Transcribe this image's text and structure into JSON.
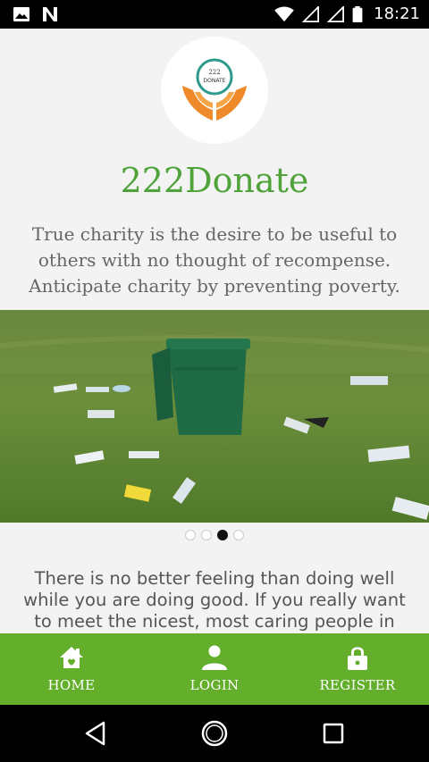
{
  "status_bar": {
    "time": "18:21"
  },
  "app": {
    "logo_text_top": "222",
    "logo_text_bottom": "DONATE",
    "title": "222Donate",
    "quote": "True charity is the desire to be useful to others with no thought of recompense. Anticipate charity by preventing poverty."
  },
  "carousel": {
    "slide_count": 4,
    "active_index": 2
  },
  "paragraph": "There is no better feeling than doing well while you are doing good. If you really want to meet the nicest, most caring people in",
  "bottom_nav": {
    "items": [
      {
        "label": "HOME",
        "icon": "home-icon"
      },
      {
        "label": "LOGIN",
        "icon": "person-icon"
      },
      {
        "label": "REGISTER",
        "icon": "lock-icon"
      }
    ]
  },
  "colors": {
    "accent": "#63ae2a",
    "title": "#4fa33a"
  }
}
